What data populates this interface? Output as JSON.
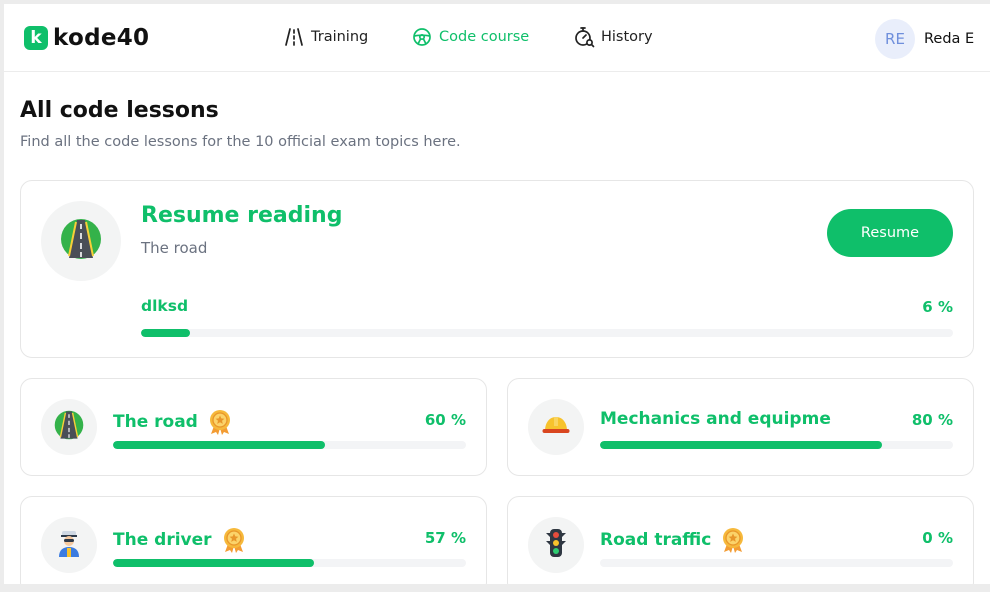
{
  "app": {
    "logo_letter": "k",
    "logo_text": "kode40"
  },
  "nav": [
    {
      "label": "Training",
      "icon": "road-icon"
    },
    {
      "label": "Code course",
      "icon": "steering-wheel-icon",
      "active": true
    },
    {
      "label": "History",
      "icon": "stopwatch-icon"
    }
  ],
  "user": {
    "initials": "RE",
    "name": "Reda E"
  },
  "page": {
    "title": "All code lessons",
    "subtitle": "Find all the code lessons for the 10 official exam topics here."
  },
  "resume": {
    "title": "Resume reading",
    "topic": "The road",
    "button_label": "Resume",
    "lesson_label": "dlksd",
    "percent_text": "6 %",
    "progress": 6,
    "icon": "road-icon"
  },
  "lessons": [
    {
      "title": "The road",
      "percent_text": "60 %",
      "progress": 60,
      "icon": "road-icon",
      "badge": "medal-icon"
    },
    {
      "title": "Mechanics and equipme",
      "percent_text": "80 %",
      "progress": 80,
      "icon": "hard-hat-icon"
    },
    {
      "title": "The driver",
      "percent_text": "57 %",
      "progress": 57,
      "icon": "driver-icon",
      "badge": "medal-icon"
    },
    {
      "title": "Road traffic",
      "percent_text": "0 %",
      "progress": 0,
      "icon": "traffic-light-icon",
      "badge": "medal-icon"
    }
  ],
  "colors": {
    "accent": "#0fbf6a",
    "muted_text": "#6b7280",
    "track": "#f3f4f6",
    "avatar_bg": "#e9eefb"
  }
}
